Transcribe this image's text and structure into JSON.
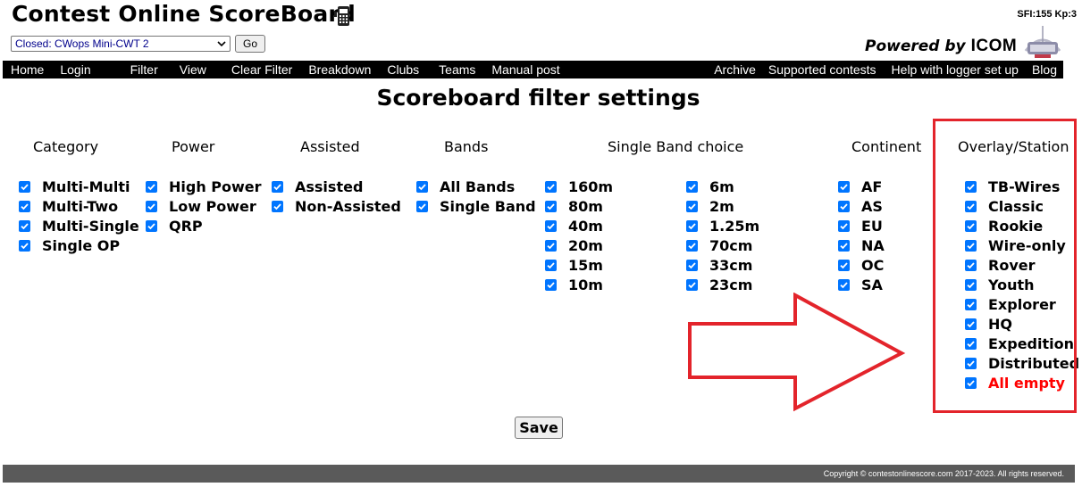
{
  "header": {
    "title": "Contest Online ScoreBoard",
    "sfi": "SFI:155 Kp:3",
    "contest_select": "Closed: CWops Mini-CWT 2",
    "go_label": "Go",
    "powered_by": "Powered by",
    "icom": "ICOM"
  },
  "nav": {
    "left": [
      "Home",
      "Login",
      "Filter",
      "View",
      "Clear Filter",
      "Breakdown",
      "Clubs",
      "Teams",
      "Manual post"
    ],
    "right": [
      "Archive",
      "Supported contests",
      "Help with logger set up",
      "Blog"
    ]
  },
  "page_title": "Scoreboard filter settings",
  "columns": {
    "category": {
      "header": "Category",
      "options": [
        "Multi-Multi",
        "Multi-Two",
        "Multi-Single",
        "Single OP"
      ]
    },
    "power": {
      "header": "Power",
      "options": [
        "High Power",
        "Low Power",
        "QRP"
      ]
    },
    "assisted": {
      "header": "Assisted",
      "options": [
        "Assisted",
        "Non-Assisted"
      ]
    },
    "bands": {
      "header": "Bands",
      "options": [
        "All Bands",
        "Single Band"
      ]
    },
    "single_band_choice": {
      "header": "Single Band choice",
      "options_a": [
        "160m",
        "80m",
        "40m",
        "20m",
        "15m",
        "10m"
      ],
      "options_b": [
        "6m",
        "2m",
        "1.25m",
        "70cm",
        "33cm",
        "23cm"
      ]
    },
    "continent": {
      "header": "Continent",
      "options": [
        "AF",
        "AS",
        "EU",
        "NA",
        "OC",
        "SA"
      ]
    },
    "overlay": {
      "header": "Overlay/Station",
      "options": [
        "TB-Wires",
        "Classic",
        "Rookie",
        "Wire-only",
        "Rover",
        "Youth",
        "Explorer",
        "HQ",
        "Expedition",
        "Distributed",
        "All empty"
      ]
    }
  },
  "all_checked": true,
  "save_label": "Save",
  "footer": "Copyright © contestonlinescore.com 2017-2023. All rights reserved.",
  "colors": {
    "checkbox": "#0075ff",
    "highlight": "#e3242b",
    "warning_text": "#ff0000",
    "navbar": "#000000",
    "footer": "#5a5a5a"
  }
}
